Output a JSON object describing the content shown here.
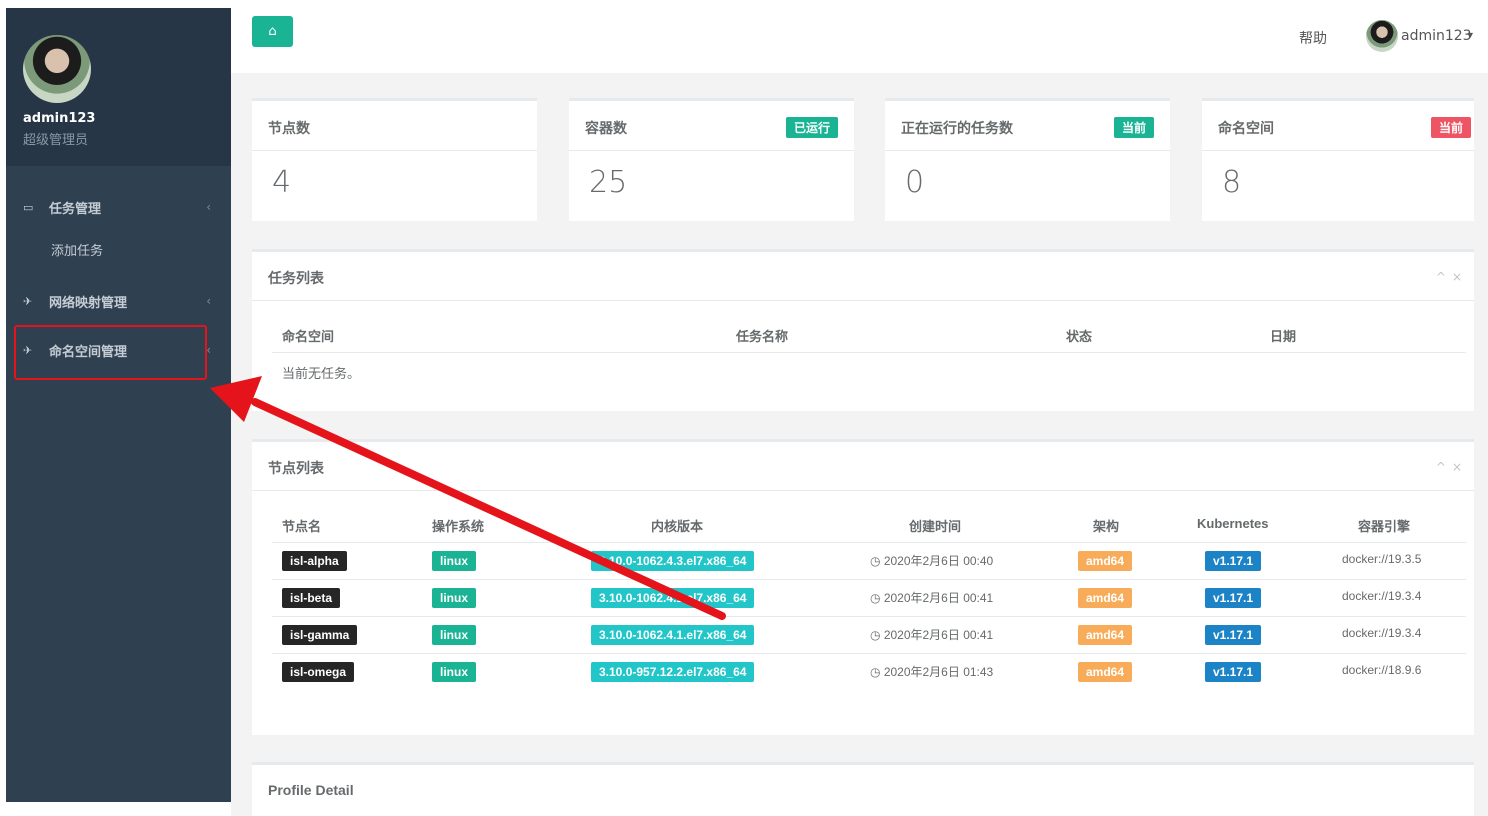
{
  "sidebar": {
    "user_name": "admin123",
    "user_role": "超级管理员",
    "menu": [
      {
        "label": "任务管理",
        "icon": "inbox-icon"
      },
      {
        "label": "添加任务"
      },
      {
        "label": "网络映射管理",
        "icon": "plane-icon"
      },
      {
        "label": "命名空间管理",
        "icon": "plane-icon"
      }
    ]
  },
  "header": {
    "home_icon": "home-icon",
    "help": "帮助",
    "user_name": "admin123"
  },
  "stats": [
    {
      "title": "节点数",
      "value": "4",
      "badge": ""
    },
    {
      "title": "容器数",
      "value": "25",
      "badge": "已运行",
      "badge_color": "#1ab394"
    },
    {
      "title": "正在运行的任务数",
      "value": "0",
      "badge": "当前",
      "badge_color": "#1ab394"
    },
    {
      "title": "命名空间",
      "value": "8",
      "badge": "当前",
      "badge_color": "#ed5565"
    }
  ],
  "tasks": {
    "title": "任务列表",
    "columns": [
      "命名空间",
      "任务名称",
      "状态",
      "日期"
    ],
    "empty": "当前无任务。"
  },
  "nodes": {
    "title": "节点列表",
    "columns": [
      "节点名",
      "操作系统",
      "内核版本",
      "创建时间",
      "架构",
      "Kubernetes",
      "容器引擎"
    ],
    "rows": [
      {
        "name": "isl-alpha",
        "os": "linux",
        "kernel": "3.10.0-1062.4.3.el7.x86_64",
        "created": "2020年2月6日 00:40",
        "arch": "amd64",
        "k8s": "v1.17.1",
        "engine": "docker://19.3.5"
      },
      {
        "name": "isl-beta",
        "os": "linux",
        "kernel": "3.10.0-1062.4.1.el7.x86_64",
        "created": "2020年2月6日 00:41",
        "arch": "amd64",
        "k8s": "v1.17.1",
        "engine": "docker://19.3.4"
      },
      {
        "name": "isl-gamma",
        "os": "linux",
        "kernel": "3.10.0-1062.4.1.el7.x86_64",
        "created": "2020年2月6日 00:41",
        "arch": "amd64",
        "k8s": "v1.17.1",
        "engine": "docker://19.3.4"
      },
      {
        "name": "isl-omega",
        "os": "linux",
        "kernel": "3.10.0-957.12.2.el7.x86_64",
        "created": "2020年2月6日 01:43",
        "arch": "amd64",
        "k8s": "v1.17.1",
        "engine": "docker://18.9.6"
      }
    ]
  },
  "profile": {
    "title": "Profile Detail"
  },
  "colors": {
    "sidebar": "#2f4050",
    "accent": "#1ab394",
    "danger": "#ed5565",
    "warning": "#f8ac59",
    "info": "#23c6c8",
    "primary": "#1c84c6",
    "dark": "#262626",
    "annotation": "#e5141b"
  }
}
